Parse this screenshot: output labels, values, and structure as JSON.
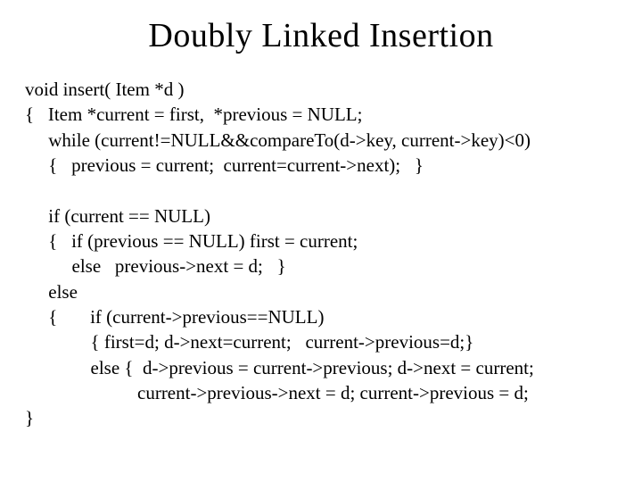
{
  "title": "Doubly Linked Insertion",
  "code": {
    "l1": "void insert( Item *d )",
    "l2": "{   Item *current = first,  *previous = NULL;",
    "l3": "     while (current!=NULL&&compareTo(d->key, current->key)<0)",
    "l4": "     {   previous = current;  current=current->next);   }",
    "l5": "     if (current == NULL)",
    "l6": "     {   if (previous == NULL) first = current;",
    "l7": "          else   previous->next = d;   }",
    "l8": "     else",
    "l9": "     {       if (current->previous==NULL)",
    "l10": "              { first=d; d->next=current;   current->previous=d;}",
    "l11": "              else {  d->previous = current->previous; d->next = current;",
    "l12": "                        current->previous->next = d; current->previous = d;",
    "l13": "}"
  }
}
